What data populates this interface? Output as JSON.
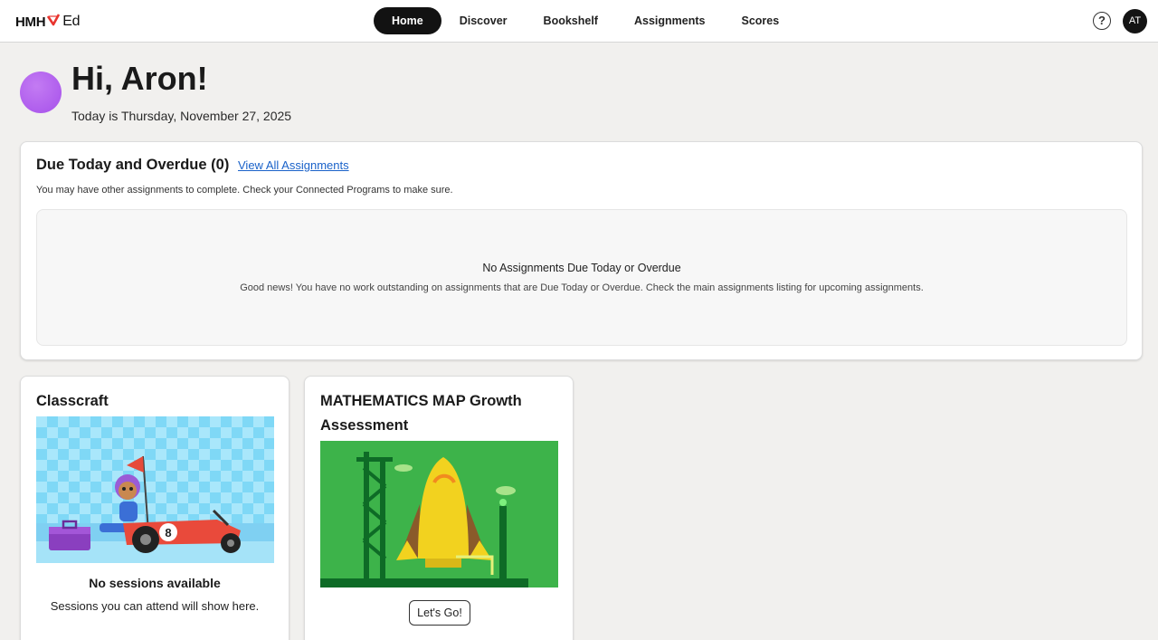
{
  "brand": {
    "name": "HMH",
    "suffix": "Ed",
    "accent": "#e8342e"
  },
  "nav": {
    "items": [
      {
        "label": "Home",
        "active": true
      },
      {
        "label": "Discover"
      },
      {
        "label": "Bookshelf"
      },
      {
        "label": "Assignments"
      },
      {
        "label": "Scores"
      }
    ]
  },
  "header": {
    "help_icon": "help-icon",
    "user_initials": "AT"
  },
  "greeting": {
    "title": "Hi, Aron!",
    "date": "Today is Thursday, November 27, 2025",
    "avatar_color": "#b15ef0"
  },
  "due": {
    "title": "Due Today and Overdue (0)",
    "link": "View All Assignments",
    "subtitle": "You may have other assignments to complete. Check your Connected Programs to make sure.",
    "empty_title": "No Assignments Due Today or Overdue",
    "empty_text": "Good news! You have no work outstanding on assignments that are Due Today or Overdue. Check the main assignments listing for upcoming assignments."
  },
  "classcraft": {
    "title": "Classcraft",
    "status": "No sessions available",
    "text": "Sessions you can attend will show here.",
    "kart_number": "8"
  },
  "math": {
    "title": "MATHEMATICS MAP Growth Assessment",
    "button": "Let's Go!"
  }
}
